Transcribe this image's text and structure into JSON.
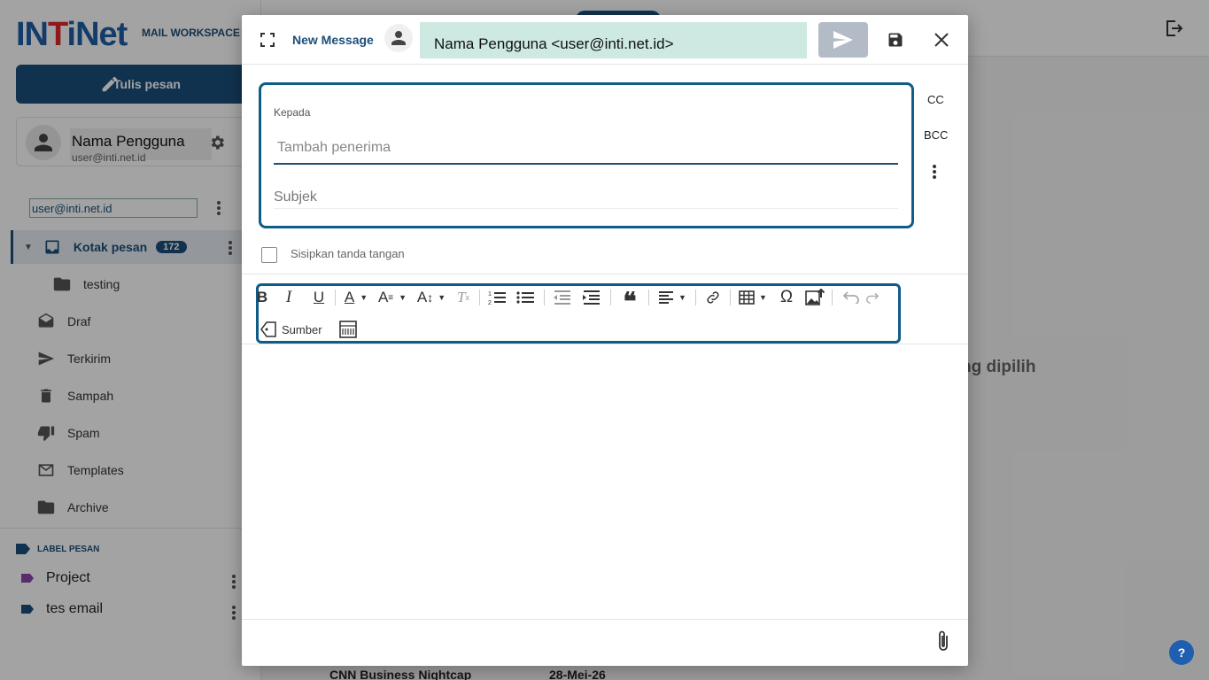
{
  "app": {
    "logo_text": "INTiNet",
    "logo_sub": "MAIL WORKSPACE",
    "compose_label": "Tulis pesan",
    "user_name": "Nama Pengguna",
    "user_email": "user@inti.net.id",
    "account_select": "user@inti.net.id",
    "folders": [
      {
        "label": "Kotak pesan",
        "badge": "172",
        "icon": "inbox-icon"
      },
      {
        "label": "testing",
        "icon": "folder-icon"
      },
      {
        "label": "Draf",
        "icon": "drafts-icon"
      },
      {
        "label": "Terkirim",
        "icon": "send-icon"
      },
      {
        "label": "Sampah",
        "icon": "trash-icon"
      },
      {
        "label": "Spam",
        "icon": "thumbs-down-icon"
      },
      {
        "label": "Templates",
        "icon": "mail-icon"
      },
      {
        "label": "Archive",
        "icon": "folder-icon"
      }
    ],
    "labels_heading": "LABEL PESAN",
    "labels": [
      {
        "label": "Project",
        "color": "#8e44ad"
      },
      {
        "label": "tes email",
        "color": "#1c4f7a"
      }
    ],
    "empty_text": "ng dipilih",
    "list_peek_sender": "CNN Business Nightcap",
    "list_peek_date": "28-Mei-26",
    "help_label": "?"
  },
  "compose": {
    "title": "New Message",
    "from": "Nama Pengguna <user@inti.net.id>",
    "to_label": "Kepada",
    "to_placeholder": "Tambah penerima",
    "subject_placeholder": "Subjek",
    "cc_label": "CC",
    "bcc_label": "BCC",
    "signature_label": "Sisipkan tanda tangan",
    "source_label": "Sumber"
  },
  "colors": {
    "brand": "#1c4f7a",
    "from_bg": "#cde9e2",
    "highlight_border": "#0f5c88"
  }
}
